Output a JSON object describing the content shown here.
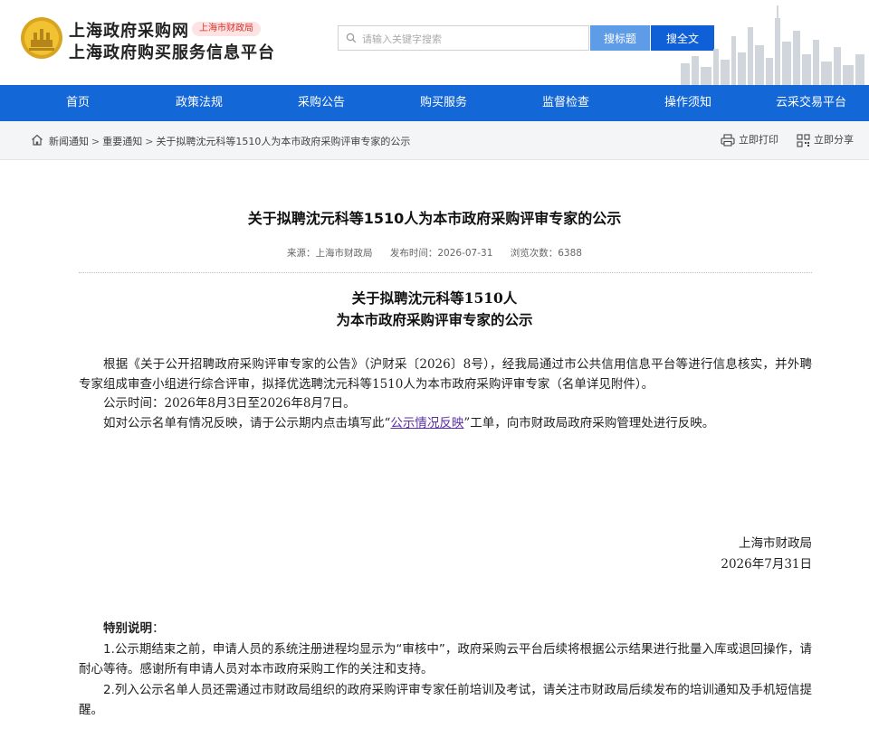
{
  "header": {
    "site_title": "上海政府采购网",
    "region_tag": "上海市财政局",
    "site_subtitle": "上海政府购买服务信息平台",
    "search_placeholder": "请输入关键字搜索",
    "search_title_button": "搜标题",
    "search_full_button": "搜全文"
  },
  "nav": {
    "items": [
      {
        "label": "首页"
      },
      {
        "label": "政策法规"
      },
      {
        "label": "采购公告"
      },
      {
        "label": "购买服务"
      },
      {
        "label": "监督检查"
      },
      {
        "label": "操作须知"
      },
      {
        "label": "云采交易平台"
      }
    ]
  },
  "breadcrumb": {
    "items": [
      "新闻通知",
      "重要通知",
      "关于拟聘沈元科等1510人为本市政府采购评审专家的公示"
    ],
    "separator": ">",
    "print_label": "立即打印",
    "share_label": "立即分享"
  },
  "article": {
    "title": "关于拟聘沈元科等1510人为本市政府采购评审专家的公示",
    "source": "来源：上海市财政局",
    "publish_time": "发布时间：2026-07-31",
    "views": "浏览次数：6388",
    "doc_title_line1": "关于拟聘沈元科等1510人",
    "doc_title_line2": "为本市政府采购评审专家的公示",
    "para1": "根据《关于公开招聘政府采购评审专家的公告》（沪财采〔2026〕8号），经我局通过市公共信用信息平台等进行信息核实，并外聘专家组成审查小组进行综合评审，拟择优选聘沈元科等1510人为本市政府采购评审专家（名单详见附件）。",
    "para2": "公示时间：2026年8月3日至2026年8月7日。",
    "para3_before": "如对公示名单有情况反映，请于公示期内点击填写此“",
    "para3_link": "公示情况反映",
    "para3_after": "”工单，向市财政局政府采购管理处进行反映。",
    "sign_org": "上海市财政局",
    "sign_date": "2026年7月31日",
    "special_title": "特别说明",
    "special_colon": "：",
    "special_1": "1.公示期结束之前，申请人员的系统注册进程均显示为“审核中”，政府采购云平台后续将根据公示结果进行批量入库或退回操作，请耐心等待。感谢所有申请人员对本市政府采购工作的关注和支持。",
    "special_2": "2.列入公示名单人员还需通过市财政局组织的政府采购评审专家任前培训及考试，请关注市财政局后续发布的培训通知及手机短信提醒。"
  },
  "colors": {
    "nav_blue": "#1467d6",
    "button_light_blue": "#5f9ce8",
    "button_dark_blue": "#0f5fd6",
    "region_tag_red": "#d93025",
    "link_purple": "#5a2ea6"
  }
}
